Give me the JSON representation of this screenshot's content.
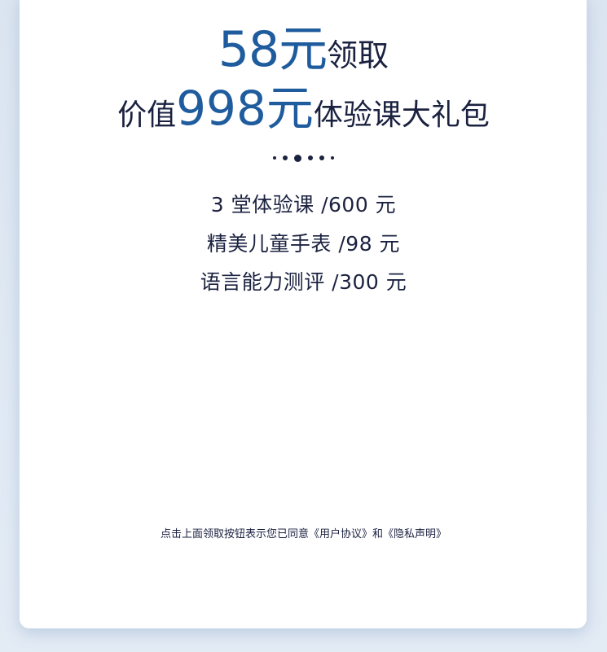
{
  "offer": {
    "price_amount": "58元",
    "price_suffix": "领取",
    "value_prefix": "价值",
    "value_amount": "998元",
    "value_suffix": "体验课大礼包"
  },
  "items": [
    "3 堂体验课 /600 元",
    "精美儿童手表 /98 元",
    "语言能力测评 /300 元"
  ],
  "agreement": {
    "text": "点击上面领取按钮表示您已同意《用户协议》和《隐私声明》"
  },
  "colors": {
    "accent": "#1f5c9e",
    "text": "#1b2240",
    "background": "#dbe5f1",
    "card": "#ffffff"
  }
}
